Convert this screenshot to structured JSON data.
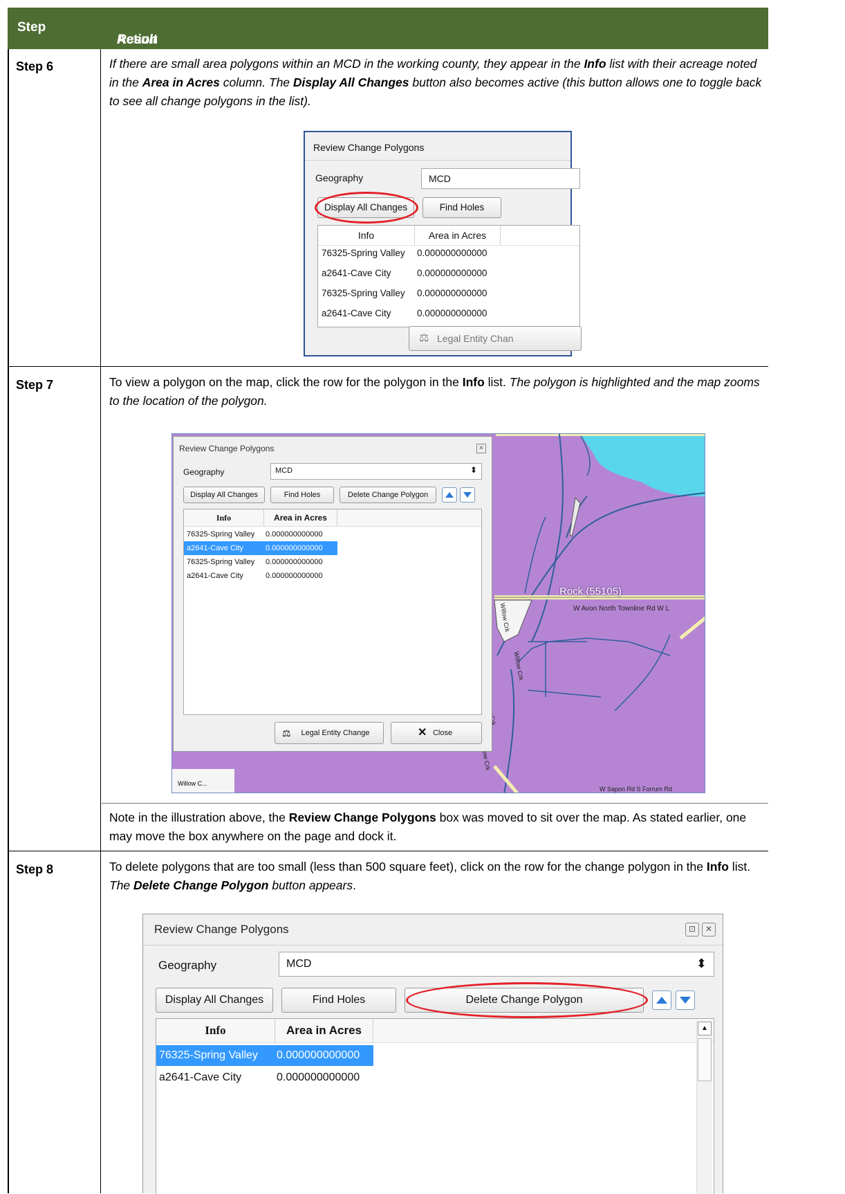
{
  "header": {
    "step_col": "Step",
    "action_col_prefix": "Action and ",
    "action_col_suffix": "Result"
  },
  "step6": {
    "label": "Step 6",
    "text": {
      "p1": "If there are small area polygons within an MCD in the working county, they appear in the ",
      "b1": "Info",
      "p2": " list with their acreage noted in the ",
      "b2": "Area in Acres",
      "p3": " column. The ",
      "b3": "Display All Changes",
      "p4": " button also becomes active (this button allows one to toggle back to see all change polygons in the list)."
    },
    "dialog": {
      "title": "Review Change Polygons",
      "geography_label": "Geography",
      "geography_value": "MCD",
      "display_all_label": "Display All Changes",
      "find_holes_label": "Find Holes",
      "col_info": "Info",
      "col_area": "Area in Acres",
      "rows": [
        {
          "info": "76325-Spring Valley",
          "area": "0.000000000000"
        },
        {
          "info": "a2641-Cave City",
          "area": "0.000000000000"
        },
        {
          "info": "76325-Spring Valley",
          "area": "0.000000000000"
        },
        {
          "info": "a2641-Cave City",
          "area": "0.000000000000"
        }
      ],
      "legal_entity_label": "Legal Entity Chan"
    }
  },
  "step7": {
    "label": "Step 7",
    "text": {
      "p1": "To view a polygon on the map, click the row for the polygon in the ",
      "b1": "Info",
      "p2": " list. ",
      "i1": "The polygon is highlighted and the map zooms to the location of the polygon."
    },
    "dialog": {
      "title": "Review Change Polygons",
      "geography_label": "Geography",
      "geography_value": "MCD",
      "display_all_label": "Display All Changes",
      "find_holes_label": "Find Holes",
      "delete_label": "Delete Change Polygon",
      "col_info": "Info",
      "col_area": "Area in Acres",
      "rows": [
        {
          "info": "76325-Spring Valley",
          "area": "0.000000000000",
          "selected": false
        },
        {
          "info": "a2641-Cave City",
          "area": "0.000000000000",
          "selected": true
        },
        {
          "info": "76325-Spring Valley",
          "area": "0.000000000000",
          "selected": false
        },
        {
          "info": "a2641-Cave City",
          "area": "0.000000000000",
          "selected": false
        }
      ],
      "legal_entity_label": "Legal Entity Change",
      "close_label": "Close"
    },
    "map": {
      "place_label": "Rock (55105)",
      "road_label": "W Avon North Townline Rd   W L",
      "creek_labels": [
        "Willow Crk",
        "Willow Crk",
        "Willow Crk",
        "Willow Crk"
      ],
      "bottom_label": "W Sapon Rd    S Forrum Rd",
      "corner_label": "Willow C...",
      "colors": {
        "polygon": "#b585d4",
        "water": "#5ad6ea",
        "road": "#f4efb0"
      }
    },
    "note": {
      "p1": "Note in the illustration above, the ",
      "b1": "Review Change Polygons",
      "p2": " box was moved to sit over the map. As stated earlier, one may move the box anywhere on the page and dock it."
    }
  },
  "step8": {
    "label": "Step 8",
    "text": {
      "p1": "To delete polygons that are too small (less than 500 square feet), click on the row for the change polygon in the ",
      "b1": "Info",
      "p2": " list. ",
      "i1": "The ",
      "bi1": "Delete Change Polygon",
      "i2": " button appears",
      "p3": "."
    },
    "dialog": {
      "title": "Review Change Polygons",
      "geography_label": "Geography",
      "geography_value": "MCD",
      "display_all_label": "Display All Changes",
      "find_holes_label": "Find Holes",
      "delete_label": "Delete Change Polygon",
      "col_info": "Info",
      "col_area": "Area in Acres",
      "rows": [
        {
          "info": "76325-Spring Valley",
          "area": "0.000000000000",
          "selected": true
        },
        {
          "info": "a2641-Cave City",
          "area": "0.000000000000",
          "selected": false
        }
      ]
    }
  }
}
